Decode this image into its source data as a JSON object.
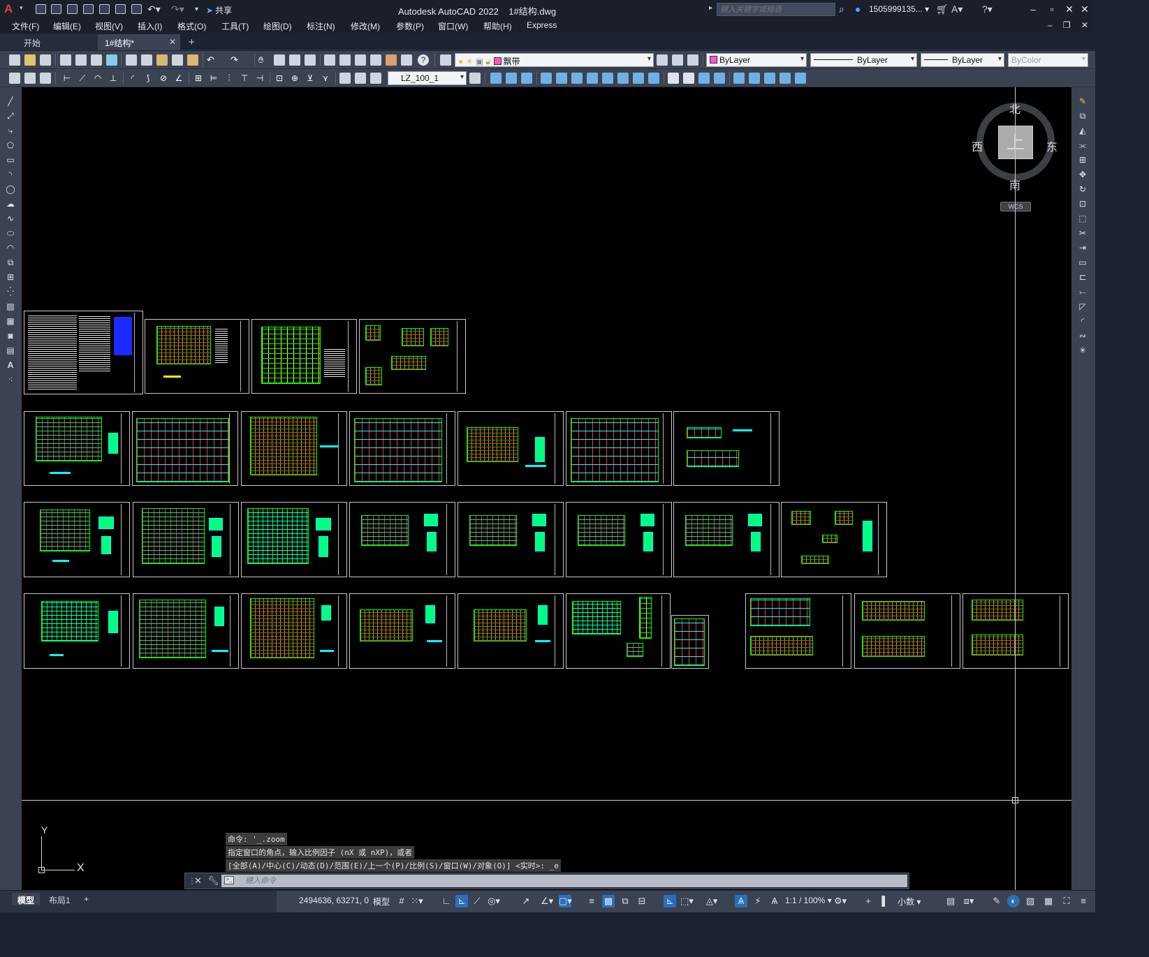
{
  "app": {
    "logo": "A",
    "share_label": "共享",
    "title": "Autodesk AutoCAD 2022",
    "filename": "1#结构.dwg",
    "search_placeholder": "键入关键字或短语",
    "user": "1505999135...",
    "doc_controls": "– ❐ ✕"
  },
  "menu": [
    "文件(F)",
    "编辑(E)",
    "视图(V)",
    "插入(I)",
    "格式(O)",
    "工具(T)",
    "绘图(D)",
    "标注(N)",
    "修改(M)",
    "参数(P)",
    "窗口(W)",
    "帮助(H)",
    "Express"
  ],
  "tabs": [
    {
      "label": "开始"
    },
    {
      "label": "1#结构*",
      "close": "✕"
    }
  ],
  "tab_add": "+",
  "toolbar": {
    "layer_name": "飘带",
    "layer_color": "#ff55cc",
    "color_value": "ByLayer",
    "color_swatch": "#ff55cc",
    "linetype_value": "ByLayer",
    "lineweight_value": "ByLayer",
    "plotstyle_value": "ByColor",
    "dimstyle_value": "LZ_100_1"
  },
  "viewcube": {
    "top_label": "上",
    "north": "北",
    "south": "南",
    "east": "东",
    "west": "西",
    "wcs_label": "WCS"
  },
  "ucs": {
    "x": "X",
    "y": "Y"
  },
  "command": {
    "history": [
      "命令: '_.zoom",
      "指定窗口的角点，输入比例因子 (nX 或 nXP)，或者",
      "[全部(A)/中心(C)/动态(D)/范围(E)/上一个(P)/比例(S)/窗口(W)/对象(O)] <实时>: _e"
    ],
    "placeholder": "键入命令",
    "prompt_icon": ">_"
  },
  "status": {
    "model_tab": "模型",
    "layout_tab": "布局1",
    "add_layout": "+",
    "coords": "2494636, 63271, 0",
    "model_label": "模型",
    "scale": "1:1 / 100%",
    "units": "小数"
  }
}
